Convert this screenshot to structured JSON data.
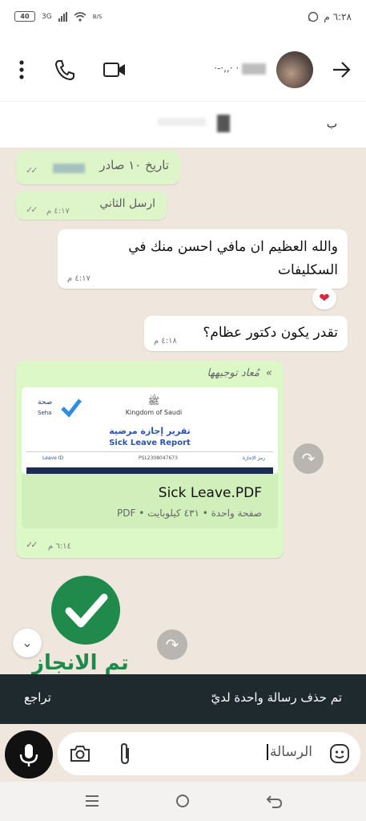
{
  "status_bar": {
    "time": "٦:٢٨ م",
    "battery": "40",
    "network": "3G",
    "data_rate": "B/S"
  },
  "header": {
    "contact_name": "·-·,,· ·"
  },
  "pinned": {
    "text": "ب"
  },
  "messages": [
    {
      "dir": "out",
      "text": "تاريخ ١٠ صادر",
      "time": ""
    },
    {
      "dir": "out",
      "text": "ارسل الثاني",
      "time": "٤:١٧ م"
    },
    {
      "dir": "in",
      "text": "والله العظيم ان مافي احسن منك في السكليفات",
      "time": "٤:١٧ م"
    },
    {
      "dir": "in",
      "text": "تقدر يكون دكتور عظام؟",
      "time": "٤:١٨ م"
    }
  ],
  "reaction": "❤",
  "forwarded": {
    "label": "مُعاد توجيهها",
    "file_name": "Sick Leave.PDF",
    "file_meta": "صفحة واحدة • ٤٣١ كيلوبايت • PDF",
    "time": "٦:١٤ م",
    "doc_preview": {
      "title_ar": "تقرير إجازة مرضية",
      "title_en": "Sick Leave Report",
      "kingdom": "Kingdom of Saudi",
      "brand_ar": "صحة",
      "brand_en": "Seha",
      "row_left": "Leave ID",
      "row_mid": "PSL2308047673",
      "row_right": "رمز الإجازة"
    }
  },
  "sticker_text": "تم الانجاز",
  "snackbar": {
    "text": "تم حذف رسالة واحدة لديّ",
    "undo": "تراجع"
  },
  "composer": {
    "placeholder": "الرسالة"
  },
  "colors": {
    "outgoing": "#dcf8c6",
    "incoming": "#ffffff",
    "accent_green": "#1f8a4c",
    "snackbar": "#1f2a2e"
  }
}
